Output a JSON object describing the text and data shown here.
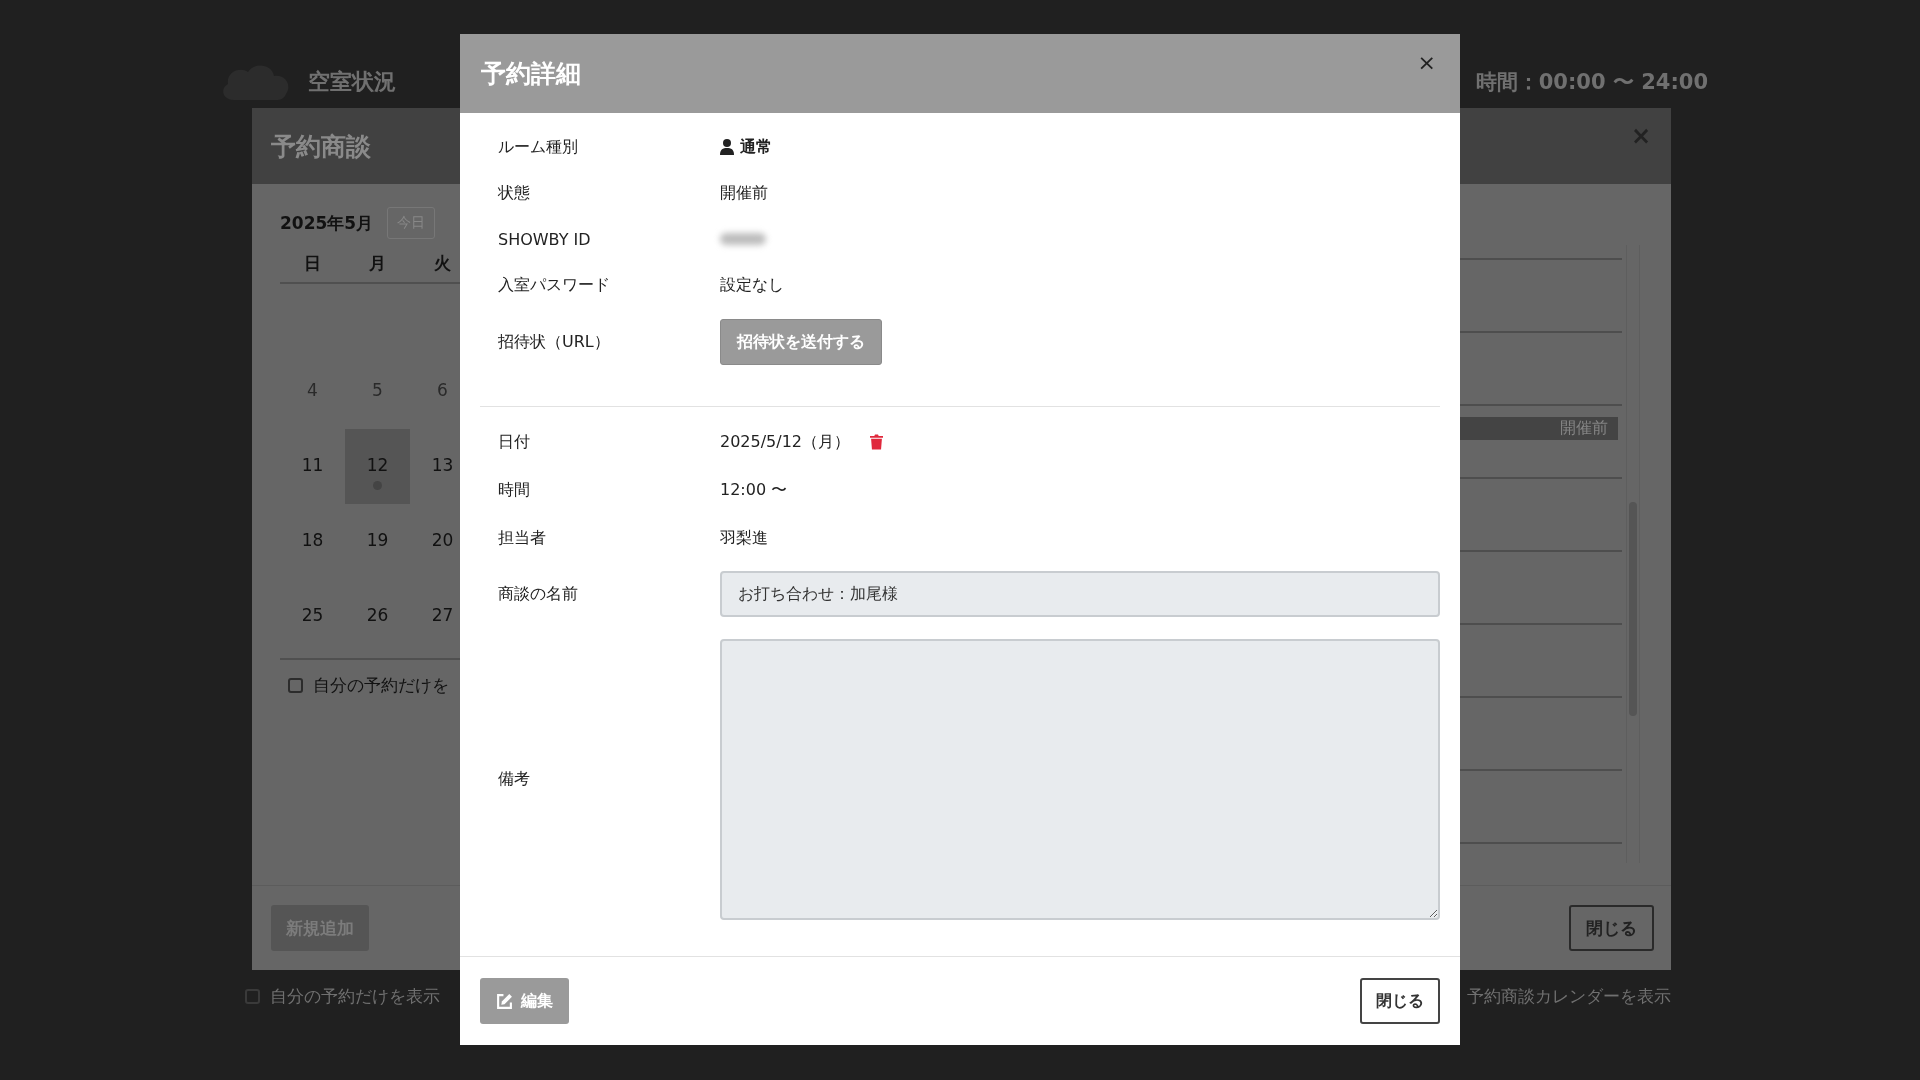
{
  "page": {
    "title": "空室状況",
    "hours": "時間：00:00 〜 24:00",
    "own_only": {
      "label": "自分の予約だけを表示",
      "checked": false
    },
    "calendar_toggle": {
      "label": "予約商談カレンダーを表示"
    }
  },
  "booking_dialog": {
    "title": "予約商談",
    "close": "×",
    "month": "2025年5月",
    "today_button": "今日",
    "weekdays": [
      "日",
      "月",
      "火"
    ],
    "weeks": [
      [
        {
          "day": "4",
          "muted": true,
          "selected": false,
          "has_event": false
        },
        {
          "day": "5",
          "muted": true,
          "selected": false,
          "has_event": false
        },
        {
          "day": "6",
          "muted": true,
          "selected": false,
          "has_event": false
        }
      ],
      [
        {
          "day": "11",
          "muted": false,
          "selected": false,
          "has_event": false
        },
        {
          "day": "12",
          "muted": false,
          "selected": true,
          "has_event": true
        },
        {
          "day": "13",
          "muted": false,
          "selected": false,
          "has_event": false
        }
      ],
      [
        {
          "day": "18",
          "muted": false,
          "selected": false,
          "has_event": false
        },
        {
          "day": "19",
          "muted": false,
          "selected": false,
          "has_event": false
        },
        {
          "day": "20",
          "muted": false,
          "selected": false,
          "has_event": false
        }
      ],
      [
        {
          "day": "25",
          "muted": false,
          "selected": false,
          "has_event": false
        },
        {
          "day": "26",
          "muted": false,
          "selected": false,
          "has_event": false
        },
        {
          "day": "27",
          "muted": false,
          "selected": false,
          "has_event": false
        }
      ]
    ],
    "own_only": {
      "label": "自分の予約だけを",
      "checked": false
    },
    "slots": [
      {
        "booked": false
      },
      {
        "booked": false
      },
      {
        "booked": false
      },
      {
        "booked": true,
        "status": "開催前"
      },
      {
        "booked": false
      },
      {
        "booked": false
      },
      {
        "booked": false
      },
      {
        "booked": false
      },
      {
        "booked": false
      }
    ],
    "add_button": "新規追加",
    "close_button": "閉じる"
  },
  "detail_dialog": {
    "title": "予約詳細",
    "close": "×",
    "fields": [
      {
        "kind": "room",
        "label": "ルーム種別",
        "value": "通常"
      },
      {
        "kind": "text",
        "label": "状態",
        "value": "開催前"
      },
      {
        "kind": "blurred",
        "label": "SHOWBY ID"
      },
      {
        "kind": "text",
        "label": "入室パスワード",
        "value": "設定なし"
      },
      {
        "kind": "button",
        "label": "招待状（URL）",
        "value": "招待状を送付する"
      }
    ],
    "schedule": [
      {
        "kind": "date",
        "label": "日付",
        "value": "2025/5/12（月）"
      },
      {
        "kind": "text",
        "label": "時間",
        "value": "12:00 〜"
      },
      {
        "kind": "text",
        "label": "担当者",
        "value": "羽梨進"
      },
      {
        "kind": "input",
        "label": "商談の名前",
        "value": "お打ち合わせ：加尾様",
        "disabled": true
      },
      {
        "kind": "textarea",
        "label": "備考",
        "disabled": true
      }
    ],
    "edit_button": "編集",
    "close_button": "閉じる"
  }
}
